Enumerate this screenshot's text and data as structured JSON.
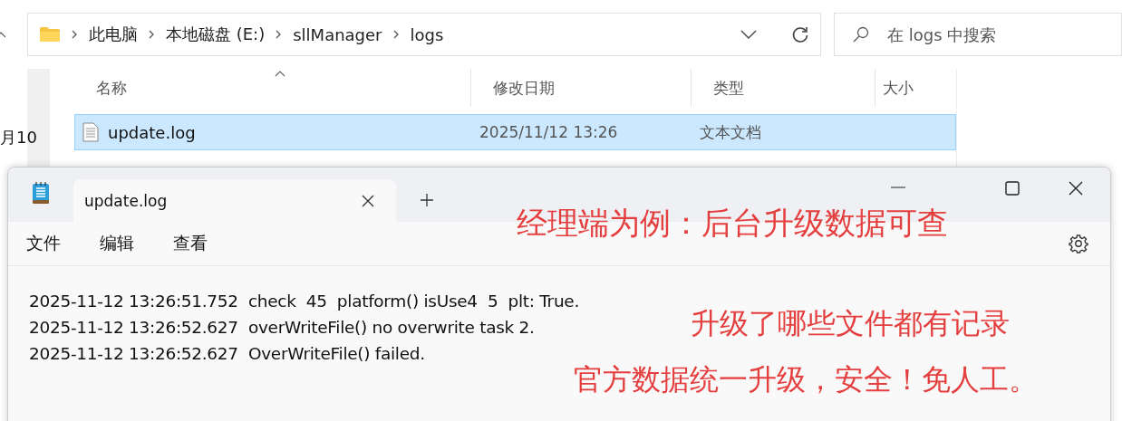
{
  "explorer": {
    "breadcrumb": [
      "此电脑",
      "本地磁盘 (E:)",
      "sllManager",
      "logs"
    ],
    "search": {
      "placeholder": "在 logs 中搜索"
    },
    "columns": [
      "名称",
      "修改日期",
      "类型",
      "大小"
    ],
    "rows": [
      {
        "name": "update.log",
        "modified": "2025/11/12 13:26",
        "type": "文本文档",
        "size": "",
        "selected": true
      }
    ]
  },
  "background_fragment": "月10",
  "notepad": {
    "tabs": [
      {
        "label": "update.log",
        "selected": true
      }
    ],
    "menu": [
      "文件",
      "编辑",
      "查看"
    ],
    "lines": [
      "2025-11-12 13:26:51.752  check  45  platform() isUse4  5  plt: True.",
      "2025-11-12 13:26:52.627  overWriteFile() no overwrite task 2.",
      "2025-11-12 13:26:52.627  OverWriteFile() failed."
    ]
  },
  "annotations": [
    "经理端为例：后台升级数据可查",
    "升级了哪些文件都有记录",
    "官方数据统一升级，安全！免人工。"
  ]
}
